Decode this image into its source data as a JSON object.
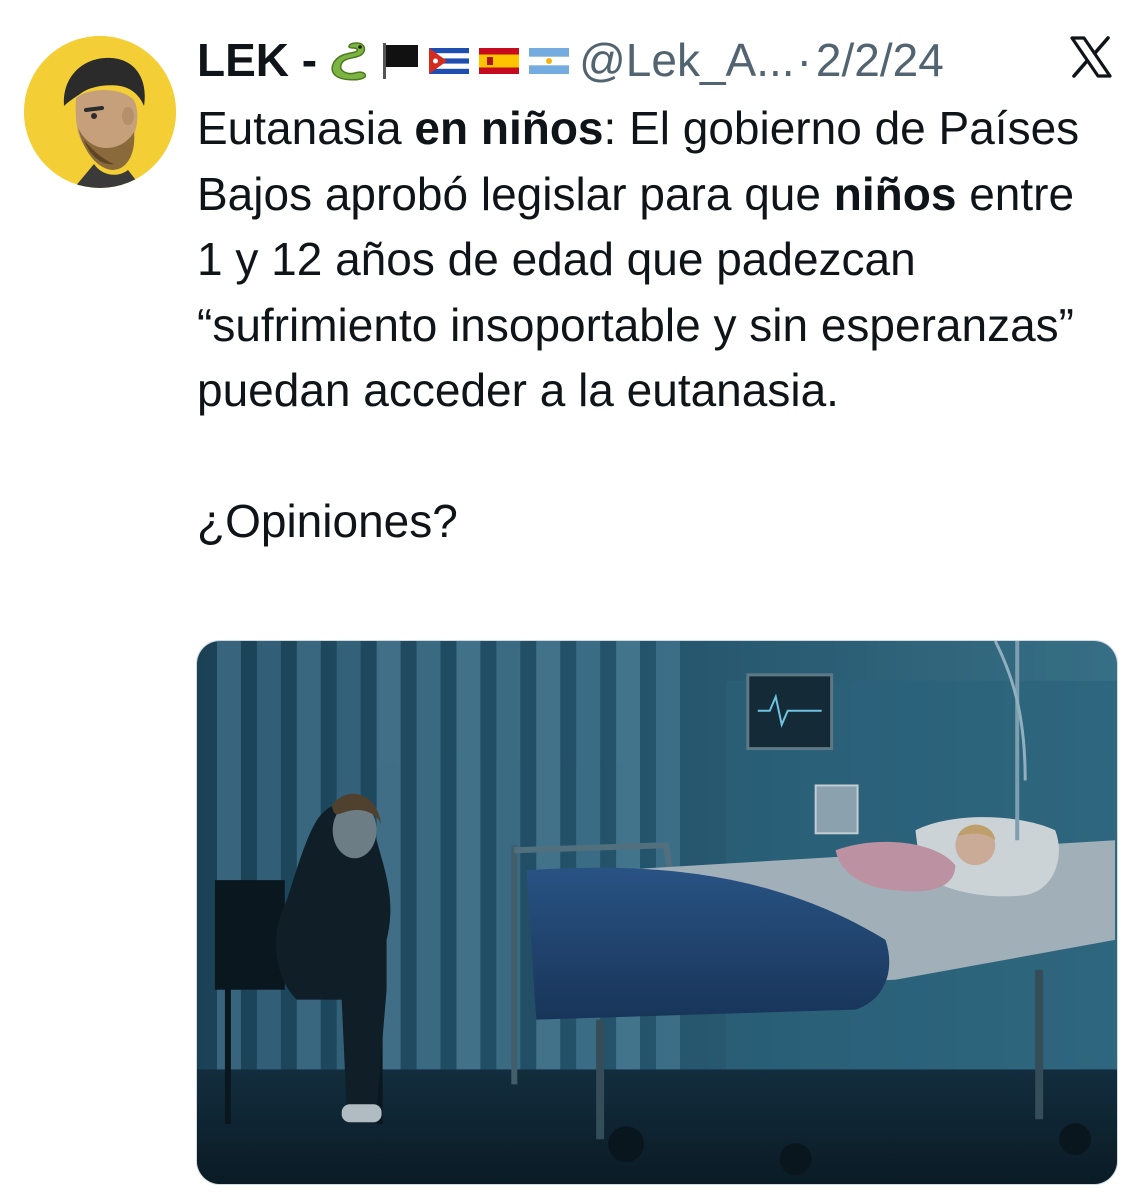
{
  "tweet": {
    "author_name": "LEK -",
    "author_emojis": [
      "snake-emoji",
      "black-flag-emoji",
      "cuba-flag-emoji",
      "spain-flag-emoji",
      "argentina-flag-emoji"
    ],
    "handle": "@Lek_A...",
    "separator": "·",
    "date": "2/2/24",
    "platform_icon": "x-logo-icon",
    "text": {
      "line1_a": "Eutanasia ",
      "line1_b": "en niños",
      "line1_c": ": El gobierno de Países Bajos aprobó legislar para que ",
      "line2_b": "niños",
      "line2_c": " entre 1 y 12 años de edad que padezcan “sufrimiento insoportable y sin esperanzas” puedan acceder a la eutanasia.",
      "question": "¿Opiniones?"
    },
    "media": {
      "kind": "photo",
      "subject": "hospital-room-image"
    }
  },
  "colors": {
    "text": "#0f1419",
    "secondary": "#536471",
    "avatar_bg": "#f3cf35",
    "border": "#cfd9de"
  }
}
